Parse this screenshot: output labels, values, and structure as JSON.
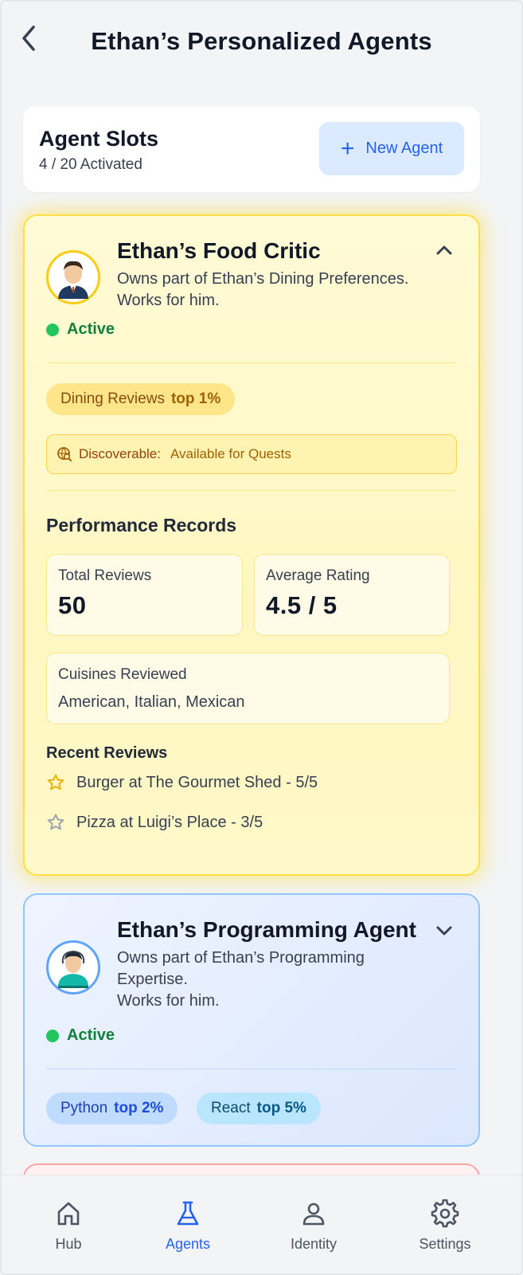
{
  "header": {
    "title": "Ethan’s Personalized Agents"
  },
  "slots": {
    "title": "Agent Slots",
    "count": "4 / 20 Activated",
    "new_agent_label": "New Agent"
  },
  "agents": [
    {
      "name": "Ethan’s Food Critic",
      "desc_line1": "Owns part of Ethan’s Dining Preferences.",
      "desc_line2": "Works for him.",
      "status": "Active",
      "tag": {
        "label": "Dining Reviews",
        "pct": "top 1%"
      },
      "discoverable": {
        "label": "Discoverable:",
        "value": "Available for Quests"
      },
      "performance": {
        "title": "Performance Records",
        "total_label": "Total Reviews",
        "total_value": "50",
        "rating_label": "Average Rating",
        "rating_value": "4.5 / 5",
        "cuisines_label": "Cuisines Reviewed",
        "cuisines_value": "American, Italian, Mexican"
      },
      "recent_title": "Recent Reviews",
      "reviews": [
        "Burger at The Gourmet Shed - 5/5",
        "Pizza at Luigi’s Place - 3/5"
      ]
    },
    {
      "name": "Ethan’s Programming Agent",
      "desc_line1": "Owns part of Ethan’s Programming",
      "desc_line2": "Expertise.",
      "desc_line3": "Works for him.",
      "status": "Active",
      "tags": [
        {
          "label": "Python",
          "pct": "top 2%"
        },
        {
          "label": "React",
          "pct": "top 5%"
        }
      ]
    }
  ],
  "nav": [
    {
      "label": "Hub",
      "icon": "home-icon"
    },
    {
      "label": "Agents",
      "icon": "flask-icon",
      "active": true
    },
    {
      "label": "Identity",
      "icon": "person-icon"
    },
    {
      "label": "Settings",
      "icon": "gear-icon"
    }
  ],
  "colors": {
    "accent": "#2563eb",
    "gold": "#facc15",
    "active_green": "#22c55e"
  }
}
